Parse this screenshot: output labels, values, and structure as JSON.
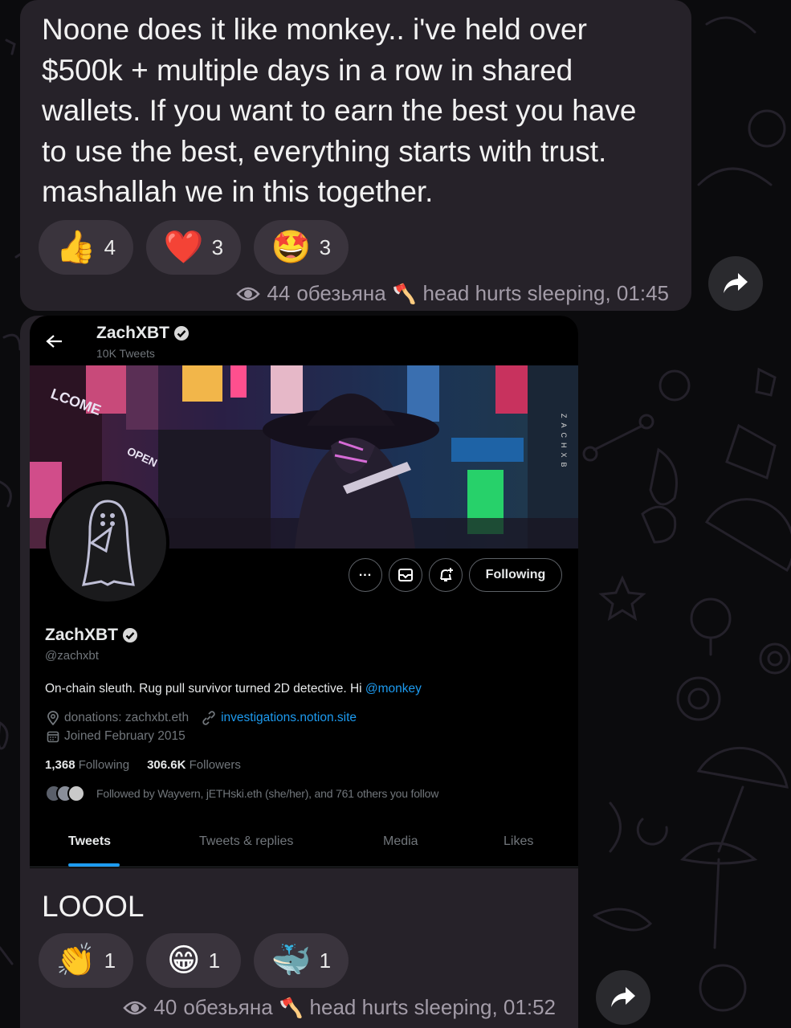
{
  "colors": {
    "bubble": "#262229",
    "reaction_bg": "#3a343d",
    "meta_text": "#a39ca8",
    "link_blue": "#1d9bf0",
    "tab_underline": "#1d9bf0"
  },
  "message1": {
    "lines": [
      "Noone does it like monkey.. i've held over",
      "$500k + multiple days in a row in shared",
      "wallets. If you want to earn the best you have",
      "to use the best,  everything starts with trust.",
      "mashallah we in this together."
    ],
    "reactions": [
      {
        "emoji": "👍",
        "count": "4"
      },
      {
        "emoji": "❤️",
        "count": "3"
      },
      {
        "emoji": "🤩",
        "count": "3"
      }
    ],
    "views": "44",
    "views_label": "обезьяна",
    "author_emoji": "🪓",
    "author": "head hurts sleeping, 01:45"
  },
  "profile": {
    "header_name": "ZachXBT",
    "tweet_count": "10K Tweets",
    "name": "ZachXBT",
    "handle": "@zachxbt",
    "bio_text": "On-chain sleuth. Rug pull survivor turned 2D detective. Hi ",
    "bio_mention": "@monkey",
    "location": "donations: zachxbt.eth",
    "link": "investigations.notion.site",
    "joined": "Joined February 2015",
    "following_count": "1,368",
    "following_label": "Following",
    "followers_count": "306.6K",
    "followers_label": "Followers",
    "followed_by": "Followed by Wayvern, jETHski.eth (she/her), and 761 others you follow",
    "following_button": "Following",
    "banner_text_welcome": "LCOME",
    "banner_text_open": "OPEN",
    "banner_text_sign": "ZACHXB",
    "tabs": [
      "Tweets",
      "Tweets & replies",
      "Media",
      "Likes"
    ]
  },
  "message2": {
    "text": "LOOOL",
    "reactions": [
      {
        "emoji": "👏",
        "count": "1"
      },
      {
        "emoji": "😁",
        "count": "1"
      },
      {
        "emoji": "🐳",
        "count": "1"
      }
    ],
    "views": "40",
    "views_label": "обезьяна",
    "author_emoji": "🪓",
    "author": "head hurts sleeping, 01:52"
  }
}
